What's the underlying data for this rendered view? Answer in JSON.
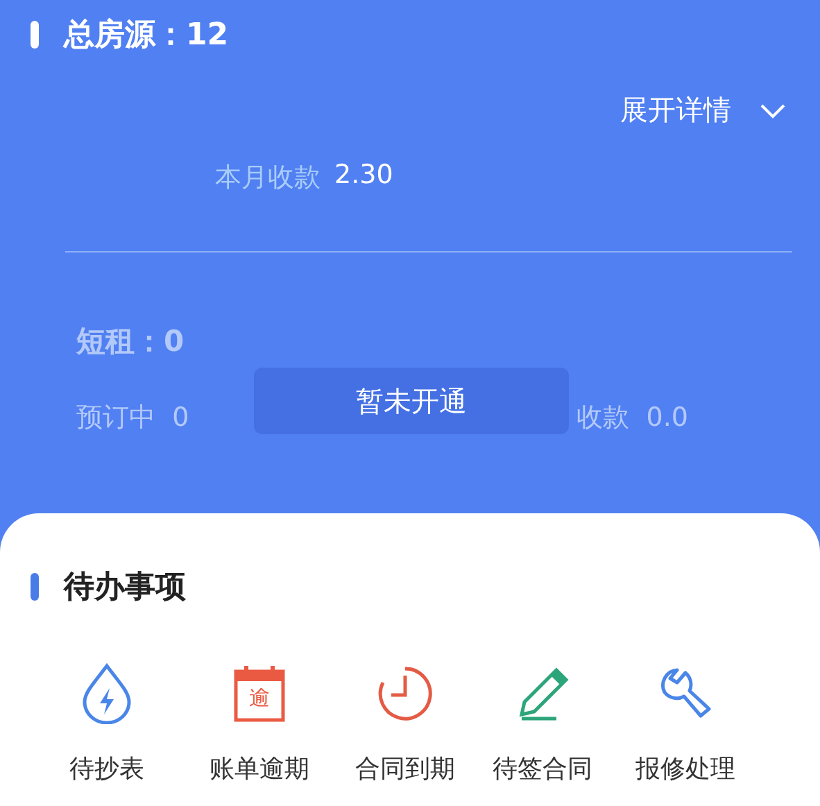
{
  "header": {
    "title": "总房源：12",
    "expand": {
      "label": "展开详情"
    },
    "monthly": {
      "label": "本月收款",
      "value": "2.30"
    }
  },
  "short_term": {
    "title": "短租：0",
    "stats": [
      {
        "label": "预订中",
        "value": "0"
      },
      {
        "label": "收款",
        "value": "0.0"
      }
    ],
    "overlay": "暂未开通",
    "disabled": true
  },
  "todo": {
    "title": "待办事项",
    "items": [
      {
        "kind": "meter",
        "label": "待抄表"
      },
      {
        "kind": "calendar",
        "label": "账单逾期",
        "icon_text": "逾"
      },
      {
        "kind": "clock",
        "label": "合同到期"
      },
      {
        "kind": "pen",
        "label": "待签合同"
      },
      {
        "kind": "wrench",
        "label": "报修处理"
      }
    ]
  }
}
